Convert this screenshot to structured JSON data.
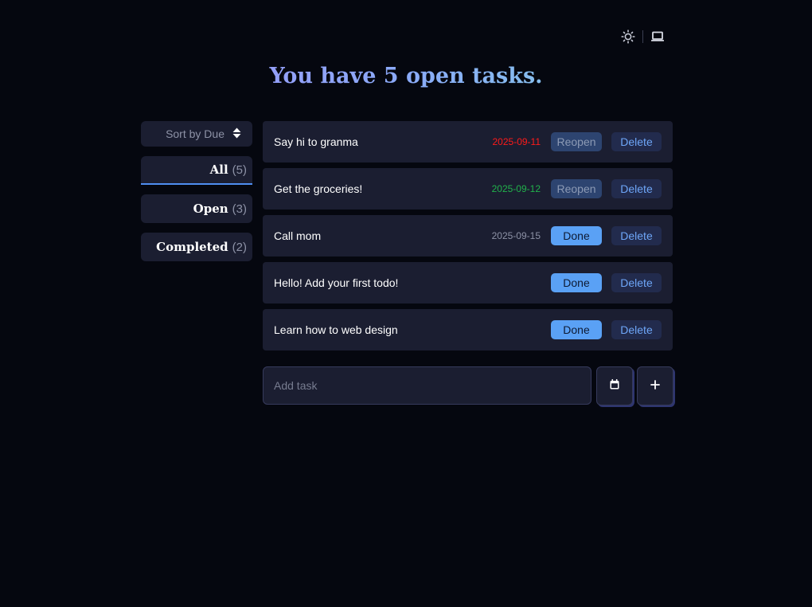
{
  "theme_switch": {
    "light_icon": "sun-icon",
    "system_icon": "laptop-icon"
  },
  "headline": "You have 5 open tasks.",
  "sidebar": {
    "sort_label": "Sort by Due",
    "sort_icon": "sort-updown-icon",
    "filters": [
      {
        "label": "All",
        "count": "(5)",
        "active": true
      },
      {
        "label": "Open",
        "count": "(3)",
        "active": false
      },
      {
        "label": "Completed",
        "count": "(2)",
        "active": false
      }
    ]
  },
  "tasks": [
    {
      "title": "Say hi to granma",
      "due": "2025-09-11",
      "due_color": "#ff1a1a",
      "action": "Reopen",
      "delete": "Delete"
    },
    {
      "title": "Get the groceries!",
      "due": "2025-09-12",
      "due_color": "#21b24b",
      "action": "Reopen",
      "delete": "Delete"
    },
    {
      "title": "Call mom",
      "due": "2025-09-15",
      "due_color": "#8d92a6",
      "action": "Done",
      "delete": "Delete"
    },
    {
      "title": "Hello! Add your first todo!",
      "due": "",
      "due_color": "",
      "action": "Done",
      "delete": "Delete"
    },
    {
      "title": "Learn how to web design",
      "due": "",
      "due_color": "",
      "action": "Done",
      "delete": "Delete"
    }
  ],
  "add_task": {
    "placeholder": "Add task",
    "calendar_icon": "calendar-icon",
    "add_icon": "plus-icon"
  },
  "colors": {
    "background": "#05070f",
    "card": "#1b1e31",
    "accent": "#5aa1f5",
    "overdue": "#ff1a1a",
    "upcoming": "#21b24b"
  }
}
